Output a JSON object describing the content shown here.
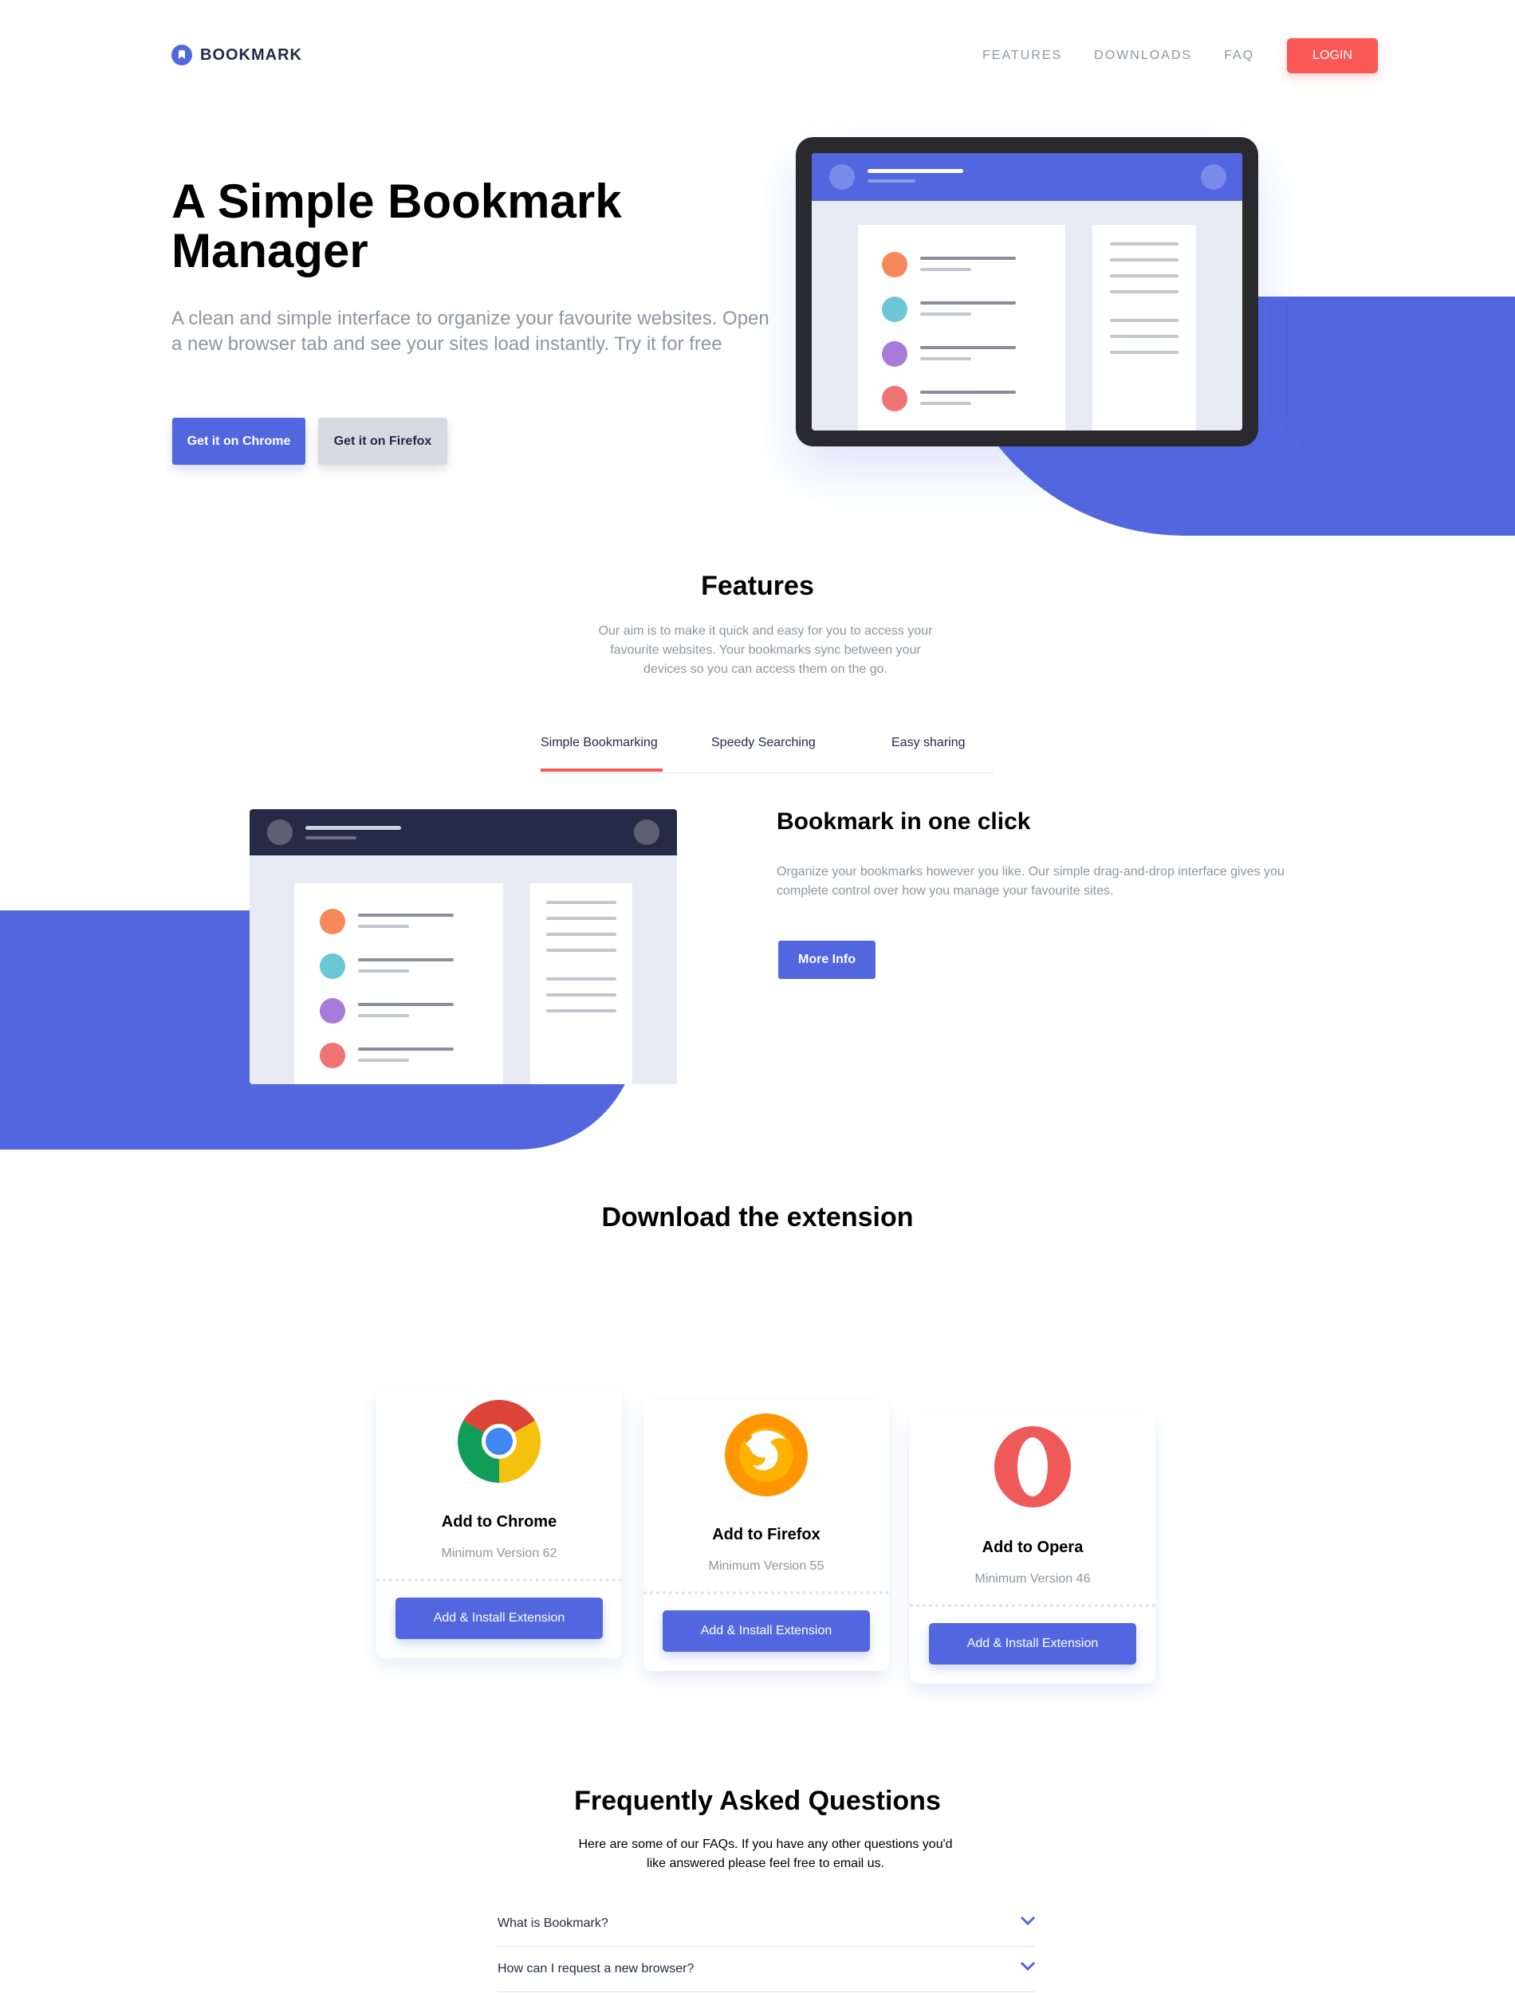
{
  "header": {
    "logo_text": "BOOKMARK",
    "nav": [
      "FEATURES",
      "DOWNLOADS",
      "FAQ"
    ],
    "login_label": "LOGIN"
  },
  "hero": {
    "title": "A Simple Bookmark Manager",
    "subtitle": "A clean and simple interface to organize your favourite websites. Open a new browser tab and see your sites load instantly. Try it for free",
    "cta_chrome": "Get it on Chrome",
    "cta_firefox": "Get it on Firefox"
  },
  "features": {
    "title": "Features",
    "description": "Our aim is to make it quick and easy for you to access your favourite websites. Your bookmarks sync between your devices so you can access them on the go.",
    "tabs": [
      "Simple Bookmarking",
      "Speedy Searching",
      "Easy sharing"
    ],
    "active_tab": "Simple Bookmarking",
    "panel": {
      "heading": "Bookmark in one click",
      "body": "Organize your bookmarks however you like. Our simple drag-and-drop interface gives you complete control over how you manage your favourite sites.",
      "button_label": "More Info"
    }
  },
  "download": {
    "title": "Download the extension",
    "cards": [
      {
        "title": "Add to Chrome",
        "version": "Minimum Version 62",
        "button": "Add & Install Extension",
        "icon": "chrome-icon"
      },
      {
        "title": "Add to Firefox",
        "version": "Minimum Version 55",
        "button": "Add & Install Extension",
        "icon": "firefox-icon"
      },
      {
        "title": "Add to Opera",
        "version": "Minimum Version 46",
        "button": "Add & Install Extension",
        "icon": "opera-icon"
      }
    ]
  },
  "faq": {
    "title": "Frequently Asked Questions",
    "description": "Here are some of our FAQs. If you have any other questions you'd like answered please feel free to email us.",
    "questions": [
      "What is Bookmark?",
      "How can I request a new browser?"
    ]
  },
  "colors": {
    "primary": "#5267DF",
    "accent": "#FA5757",
    "dark": "#242A45",
    "muted": "#9194A1",
    "light": "#E8EAF4"
  }
}
